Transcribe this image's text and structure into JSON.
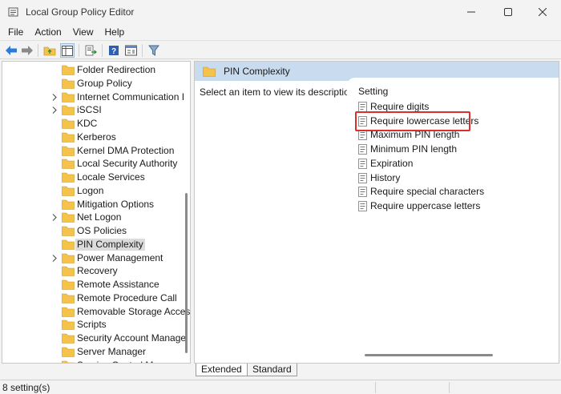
{
  "window": {
    "title": "Local Group Policy Editor"
  },
  "menu": [
    "File",
    "Action",
    "View",
    "Help"
  ],
  "toolbar": [
    "back-arrow-icon",
    "forward-arrow-icon",
    "up-folder-icon",
    "show-hide-tree-icon",
    "export-list-icon",
    "help-icon",
    "properties-icon",
    "filter-icon"
  ],
  "tree": {
    "items": [
      {
        "label": "Folder Redirection",
        "expandable": false,
        "selected": false
      },
      {
        "label": "Group Policy",
        "expandable": false,
        "selected": false
      },
      {
        "label": "Internet Communication I",
        "expandable": true,
        "selected": false
      },
      {
        "label": "iSCSI",
        "expandable": true,
        "selected": false
      },
      {
        "label": "KDC",
        "expandable": false,
        "selected": false
      },
      {
        "label": "Kerberos",
        "expandable": false,
        "selected": false
      },
      {
        "label": "Kernel DMA Protection",
        "expandable": false,
        "selected": false
      },
      {
        "label": "Local Security Authority",
        "expandable": false,
        "selected": false
      },
      {
        "label": "Locale Services",
        "expandable": false,
        "selected": false
      },
      {
        "label": "Logon",
        "expandable": false,
        "selected": false
      },
      {
        "label": "Mitigation Options",
        "expandable": false,
        "selected": false
      },
      {
        "label": "Net Logon",
        "expandable": true,
        "selected": false
      },
      {
        "label": "OS Policies",
        "expandable": false,
        "selected": false
      },
      {
        "label": "PIN Complexity",
        "expandable": false,
        "selected": true
      },
      {
        "label": "Power Management",
        "expandable": true,
        "selected": false
      },
      {
        "label": "Recovery",
        "expandable": false,
        "selected": false
      },
      {
        "label": "Remote Assistance",
        "expandable": false,
        "selected": false
      },
      {
        "label": "Remote Procedure Call",
        "expandable": false,
        "selected": false
      },
      {
        "label": "Removable Storage Acces",
        "expandable": false,
        "selected": false
      },
      {
        "label": "Scripts",
        "expandable": false,
        "selected": false
      },
      {
        "label": "Security Account Manage",
        "expandable": false,
        "selected": false
      },
      {
        "label": "Server Manager",
        "expandable": false,
        "selected": false
      },
      {
        "label": "Service Control Manager",
        "expandable": false,
        "selected": false
      }
    ]
  },
  "details": {
    "header": "PIN Complexity",
    "description": "Select an item to view its description.",
    "column": "Setting",
    "settings": [
      "Require digits",
      "Require lowercase letters",
      "Maximum PIN length",
      "Minimum PIN length",
      "Expiration",
      "History",
      "Require special characters",
      "Require uppercase letters"
    ],
    "highlighted": "Require lowercase letters",
    "highlight_color": "#d9302b"
  },
  "tabs": [
    "Extended",
    "Standard"
  ],
  "status": {
    "text": "8 setting(s)"
  },
  "colors": {
    "header_bg": "#c9dcef",
    "folder": "#f5c34a",
    "selected_bg": "#dcdcdc"
  }
}
